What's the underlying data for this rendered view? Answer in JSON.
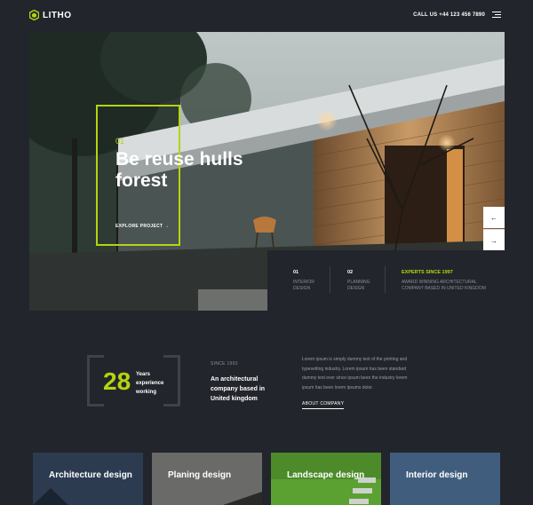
{
  "header": {
    "logo_text": "LITHO",
    "call_text": "CALL US +44 123 456 7890",
    "menu_icon": "hamburger-icon"
  },
  "hero": {
    "slide_number": "01",
    "title": "Be reuse hulls forest",
    "explore_link": "EXPLORE PROJECT →",
    "prev_arrow": "←",
    "next_arrow": "→",
    "accent_color": "#b5d40f"
  },
  "info": {
    "items": [
      {
        "num": "01",
        "label": "INTERIOR DESIGN"
      },
      {
        "num": "02",
        "label": "PLANNING DESIGN"
      }
    ],
    "experts_heading": "EXPERTS SINCE 1997",
    "experts_text": "AWARD WINNING ARCHITECTURAL COMPANY BASED IN UNITED KINGDOM"
  },
  "about": {
    "years": "28",
    "years_text": "Years experience working",
    "since": "SINCE 1992",
    "headline": "An architectural company based in United kingdom",
    "lorem": "Lorem ipsum is simply dummy text of the printing and typesetting industry. Lorem ipsum has been standard dummy text ever since ipsum been the industry lorem ipsum has been lorem ipsums dolor.",
    "link": "ABOUT COMPANY"
  },
  "services": [
    {
      "label": "Architecture design",
      "color": "#2e3d52"
    },
    {
      "label": "Planing design",
      "color": "#6a6a68"
    },
    {
      "label": "Landscape design",
      "color": "#4f8a2b"
    },
    {
      "label": "Interior design",
      "color": "#3a5677"
    }
  ]
}
